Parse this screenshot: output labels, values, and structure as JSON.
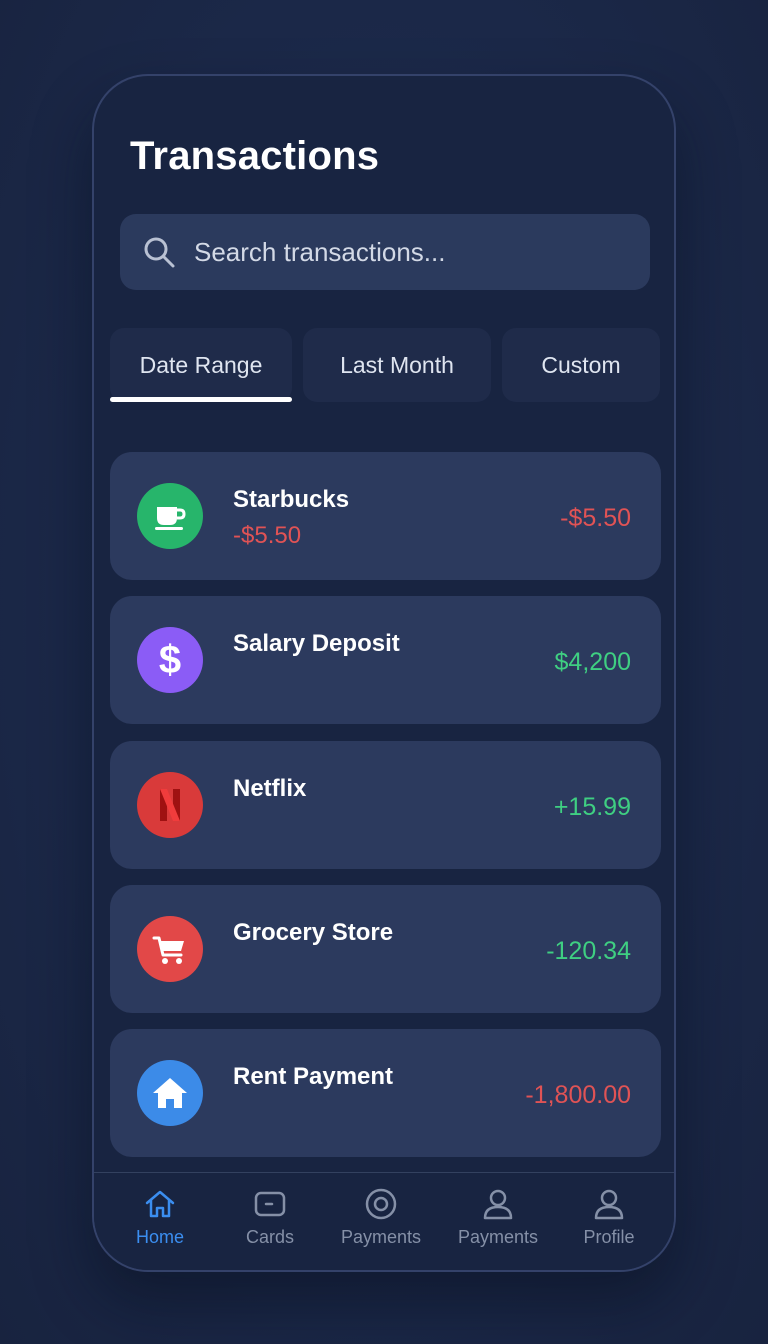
{
  "header": {
    "title": "Transactions"
  },
  "search": {
    "placeholder": "Search transactions..."
  },
  "filters": [
    {
      "label": "Date Range",
      "active": true
    },
    {
      "label": "Last Month",
      "active": false
    },
    {
      "label": "Custom",
      "active": false
    }
  ],
  "transactions": [
    {
      "name": "Starbucks",
      "sub_amount": "-$5.50",
      "amount": "-$5.50",
      "amount_color": "#e05355",
      "icon": "coffee-cup-icon",
      "icon_bg": "#27b56b"
    },
    {
      "name": "Salary Deposit",
      "amount": "$4,200",
      "amount_color": "#3fcf82",
      "icon": "dollar-icon",
      "icon_bg": "#8b5cf6"
    },
    {
      "name": "Netflix",
      "amount": "+15.99",
      "amount_color": "#3fcf82",
      "icon": "netflix-icon",
      "icon_bg": "#d93a3a"
    },
    {
      "name": "Grocery Store",
      "amount": "-120.34",
      "amount_color": "#3fcf82",
      "icon": "shopping-cart-icon",
      "icon_bg": "#e24848"
    },
    {
      "name": "Rent Payment",
      "amount": "-1,800.00",
      "amount_color": "#e05355",
      "icon": "home-icon",
      "icon_bg": "#3c8be8"
    }
  ],
  "nav": [
    {
      "label": "Home",
      "icon": "home-icon",
      "active": true
    },
    {
      "label": "Cards",
      "icon": "card-icon",
      "active": false
    },
    {
      "label": "Payments",
      "icon": "target-icon",
      "active": false
    },
    {
      "label": "Payments",
      "icon": "user-icon",
      "active": false
    },
    {
      "label": "Profile",
      "icon": "user-icon",
      "active": false
    }
  ],
  "colors": {
    "background": "#1c2948",
    "card": "#2c3a5e",
    "negative": "#e05355",
    "positive": "#3fcf82",
    "accent": "#3b8ef0"
  }
}
